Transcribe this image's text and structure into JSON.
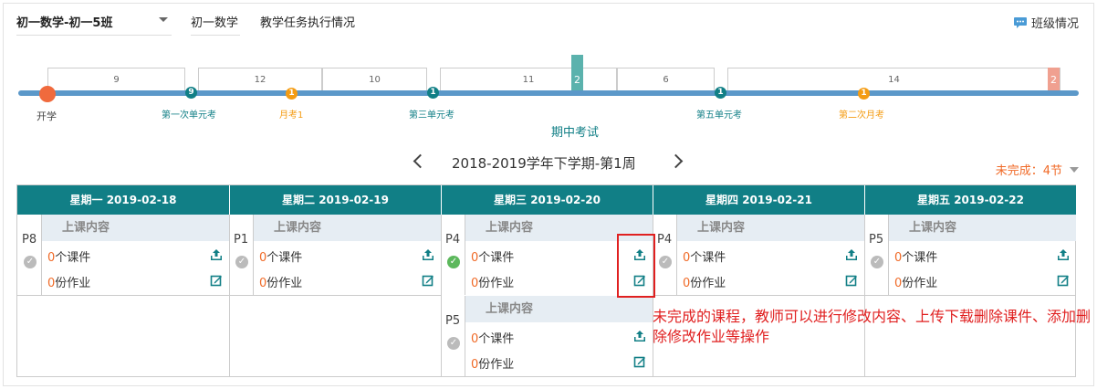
{
  "header": {
    "class_select": "初一数学-初一5班",
    "subject": "初一数学",
    "task_title": "教学任务执行情况",
    "class_info": "班级情况"
  },
  "timeline": {
    "segments": [
      "9",
      "12",
      "10",
      "11",
      "6",
      "14"
    ],
    "start_label": "开学",
    "markers": [
      {
        "label": "第一次单元考",
        "count": "9"
      },
      {
        "label": "月考1",
        "count": "1"
      },
      {
        "label": "第三单元考",
        "count": "1"
      },
      {
        "label": "第五单元考",
        "count": "1"
      },
      {
        "label": "第二次月考",
        "count": "1"
      }
    ],
    "midterm_count": "2",
    "midterm_label": "期中考试",
    "final_count": "2"
  },
  "week_label": "2018-2019学年下学期-第1周",
  "unfinished": "未完成：4节",
  "days": [
    "星期一 2019-02-18",
    "星期二 2019-02-19",
    "星期三 2019-02-20",
    "星期四 2019-02-21",
    "星期五 2019-02-22"
  ],
  "lesson_header": "上课内容",
  "lessons": [
    {
      "period": "P8",
      "courseware": "0",
      "courseware_label": "个课件",
      "homework": "0",
      "homework_label": "份作业",
      "done": false
    },
    {
      "period": "P1",
      "courseware": "0",
      "courseware_label": "个课件",
      "homework": "0",
      "homework_label": "份作业",
      "done": false
    },
    {
      "period": "P4",
      "courseware": "0",
      "courseware_label": "个课件",
      "homework": "0",
      "homework_label": "份作业",
      "done": true
    },
    {
      "period": "P4",
      "courseware": "0",
      "courseware_label": "个课件",
      "homework": "0",
      "homework_label": "份作业",
      "done": false
    },
    {
      "period": "P5",
      "courseware": "0",
      "courseware_label": "个课件",
      "homework": "0",
      "homework_label": "份作业",
      "done": false
    },
    {
      "period": "P5",
      "courseware": "0",
      "courseware_label": "个课件",
      "homework": "0",
      "homework_label": "份作业",
      "done": false
    }
  ],
  "annotation": "未完成的课程，教师可以进行修改内容、上传下载删除课件、添加删除修改作业等操作",
  "colors": {
    "teal": "#117f86",
    "orange": "#f49c13",
    "timeline": "#5b98c9",
    "start": "#f06a3d",
    "red": "#e02020",
    "highlight": "#f06a27"
  }
}
